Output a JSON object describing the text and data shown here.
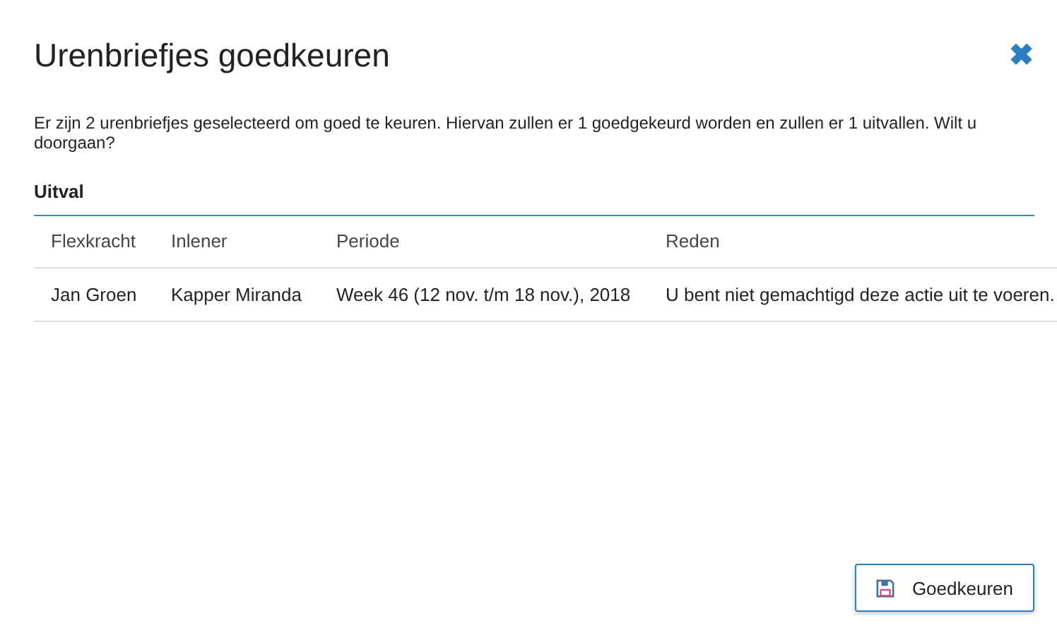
{
  "dialog": {
    "title": "Urenbriefjes goedkeuren",
    "close": "✖"
  },
  "message": "Er zijn 2 urenbriefjes geselecteerd om goed te keuren. Hiervan zullen er 1 goedgekeurd worden en zullen er 1 uitvallen. Wilt u doorgaan?",
  "section": {
    "title": "Uitval"
  },
  "table": {
    "columns": [
      "Flexkracht",
      "Inlener",
      "Periode",
      "Reden"
    ],
    "rows": [
      [
        "Jan Groen",
        "Kapper Miranda",
        "Week 46 (12 nov. t/m 18 nov.), 2018",
        "U bent niet gemachtigd deze actie uit te voeren."
      ]
    ]
  },
  "buttons": [
    {
      "label": "Goedkeuren"
    }
  ]
}
